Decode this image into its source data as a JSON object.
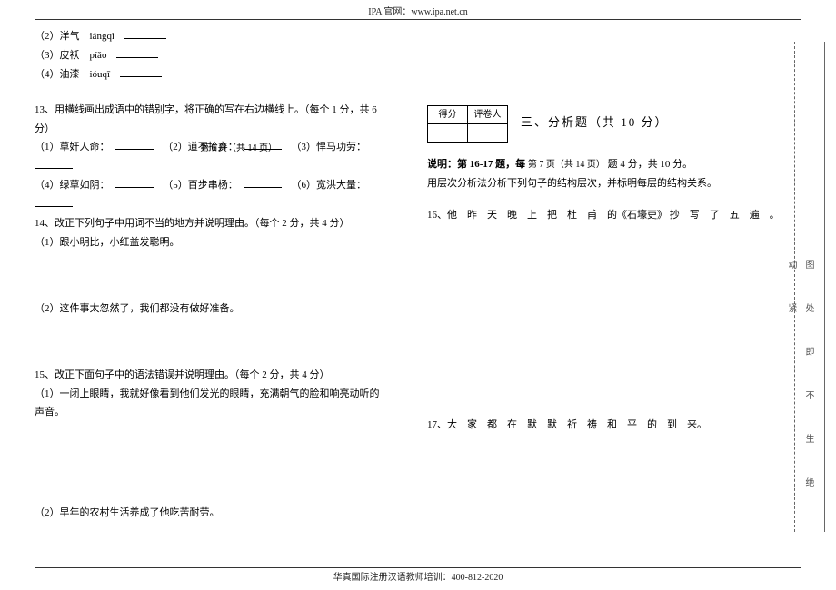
{
  "header": "IPA 官网：www.ipa.net.cn",
  "left": {
    "l2": "（2）洋气　iángqì",
    "l3": "（3）皮袄　píǎo",
    "l4": "（4）油漆　ióuqī",
    "q13": "13、用横线画出成语中的错别字，将正确的写在右边横线上。（每个 1 分，共 6 分）",
    "q13items": {
      "a": "（1）草奸人命：",
      "b": "（2）道不拾弃：",
      "c": "（3）悍马功劳：",
      "d": "（4）绿草如阴：",
      "e": "（5）百步串杨：",
      "f": "（6）宽洪大量："
    },
    "q14": "14、改正下列句子中用词不当的地方并说明理由。（每个 2 分，共 4 分）",
    "q14a": "（1）跟小明比，小红益发聪明。",
    "q14b": "（2）这件事太忽然了，我们都没有做好准备。",
    "q15": "15、改正下面句子中的语法错误并说明理由。（每个 2 分，共 4 分）",
    "q15a": "（1）一闭上眼睛，我就好像看到他们发光的眼睛，充满朝气的脸和响亮动听的声音。",
    "q15b": "（2）早年的农村生活养成了他吃苦耐劳。",
    "page": "第 6 页（共 14 页）"
  },
  "right": {
    "score": {
      "c1": "得分",
      "c2": "评卷人"
    },
    "section": "三、分析题（共 10 分）",
    "desc_a": "说明：第 16-17 题，每",
    "desc_b": "题 4 分，共 10 分。",
    "desc_note": "用层次分析法分析下列句子的结构层次，并标明每层的结构关系。",
    "q16": "16、他　昨　天　晚　上　把　杜　甫　的《石壕吏》 抄　写　了　五　遍　。",
    "q17": "17、大　家　都　在　默　默　祈　祷　和　平　的　到　来。",
    "page": "第 7 页（共 14 页）"
  },
  "side": "图　处　即　不　生　绝　动　紧",
  "footer": "华真国际注册汉语教师培训：400-812-2020"
}
